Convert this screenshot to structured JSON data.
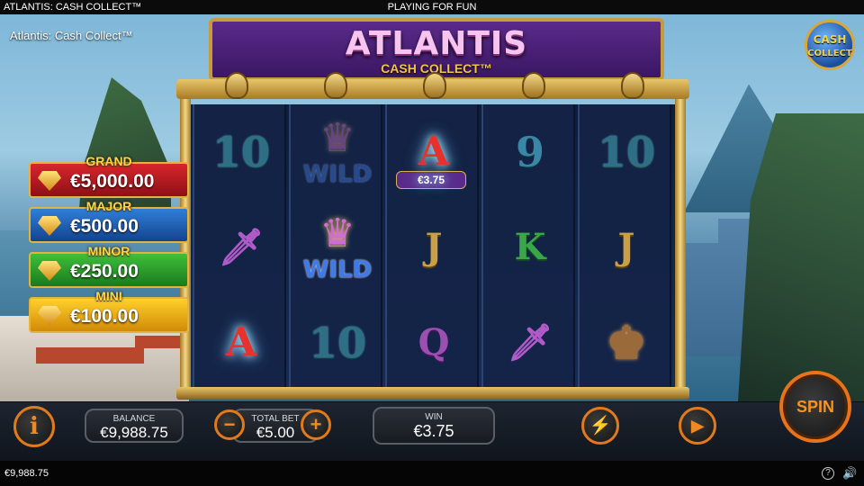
{
  "top_bar": {
    "game_name": "ATLANTIS: CASH COLLECT™",
    "mode": "PLAYING FOR FUN"
  },
  "overlay_title": "Atlantis: Cash Collect™",
  "logo": {
    "title": "ATLANTIS",
    "subtitle": "CASH COLLECT™"
  },
  "badge": {
    "line1": "CASH",
    "line2": "COLLECT"
  },
  "jackpots": [
    {
      "label": "GRAND",
      "value": "€5,000.00",
      "color": "#d8262d"
    },
    {
      "label": "MAJOR",
      "value": "€500.00",
      "color": "#2f7fd8"
    },
    {
      "label": "MINOR",
      "value": "€250.00",
      "color": "#3fbf3b"
    },
    {
      "label": "MINI",
      "value": "€100.00",
      "color": "#ffd12c"
    }
  ],
  "reels": {
    "reel1": [
      "10",
      "dagger",
      "A"
    ],
    "reel2": [
      "WILD",
      "WILD",
      "10"
    ],
    "reel3": [
      "A",
      "J",
      "Q"
    ],
    "reel4": [
      "9",
      "K",
      "dagger"
    ],
    "reel5": [
      "10",
      "J",
      "king"
    ],
    "cash_value": "€3.75"
  },
  "controls": {
    "balance_label": "BALANCE",
    "balance_value": "€9,988.75",
    "bet_label": "TOTAL BET",
    "bet_value": "€5.00",
    "win_label": "WIN",
    "win_value": "€3.75",
    "spin_label": "SPIN"
  },
  "bottom_bar": {
    "balance": "€9,988.75"
  },
  "icons": [
    "info-icon",
    "minus-icon",
    "plus-icon",
    "turbo-icon",
    "autoplay-icon",
    "help-icon",
    "sound-icon"
  ]
}
